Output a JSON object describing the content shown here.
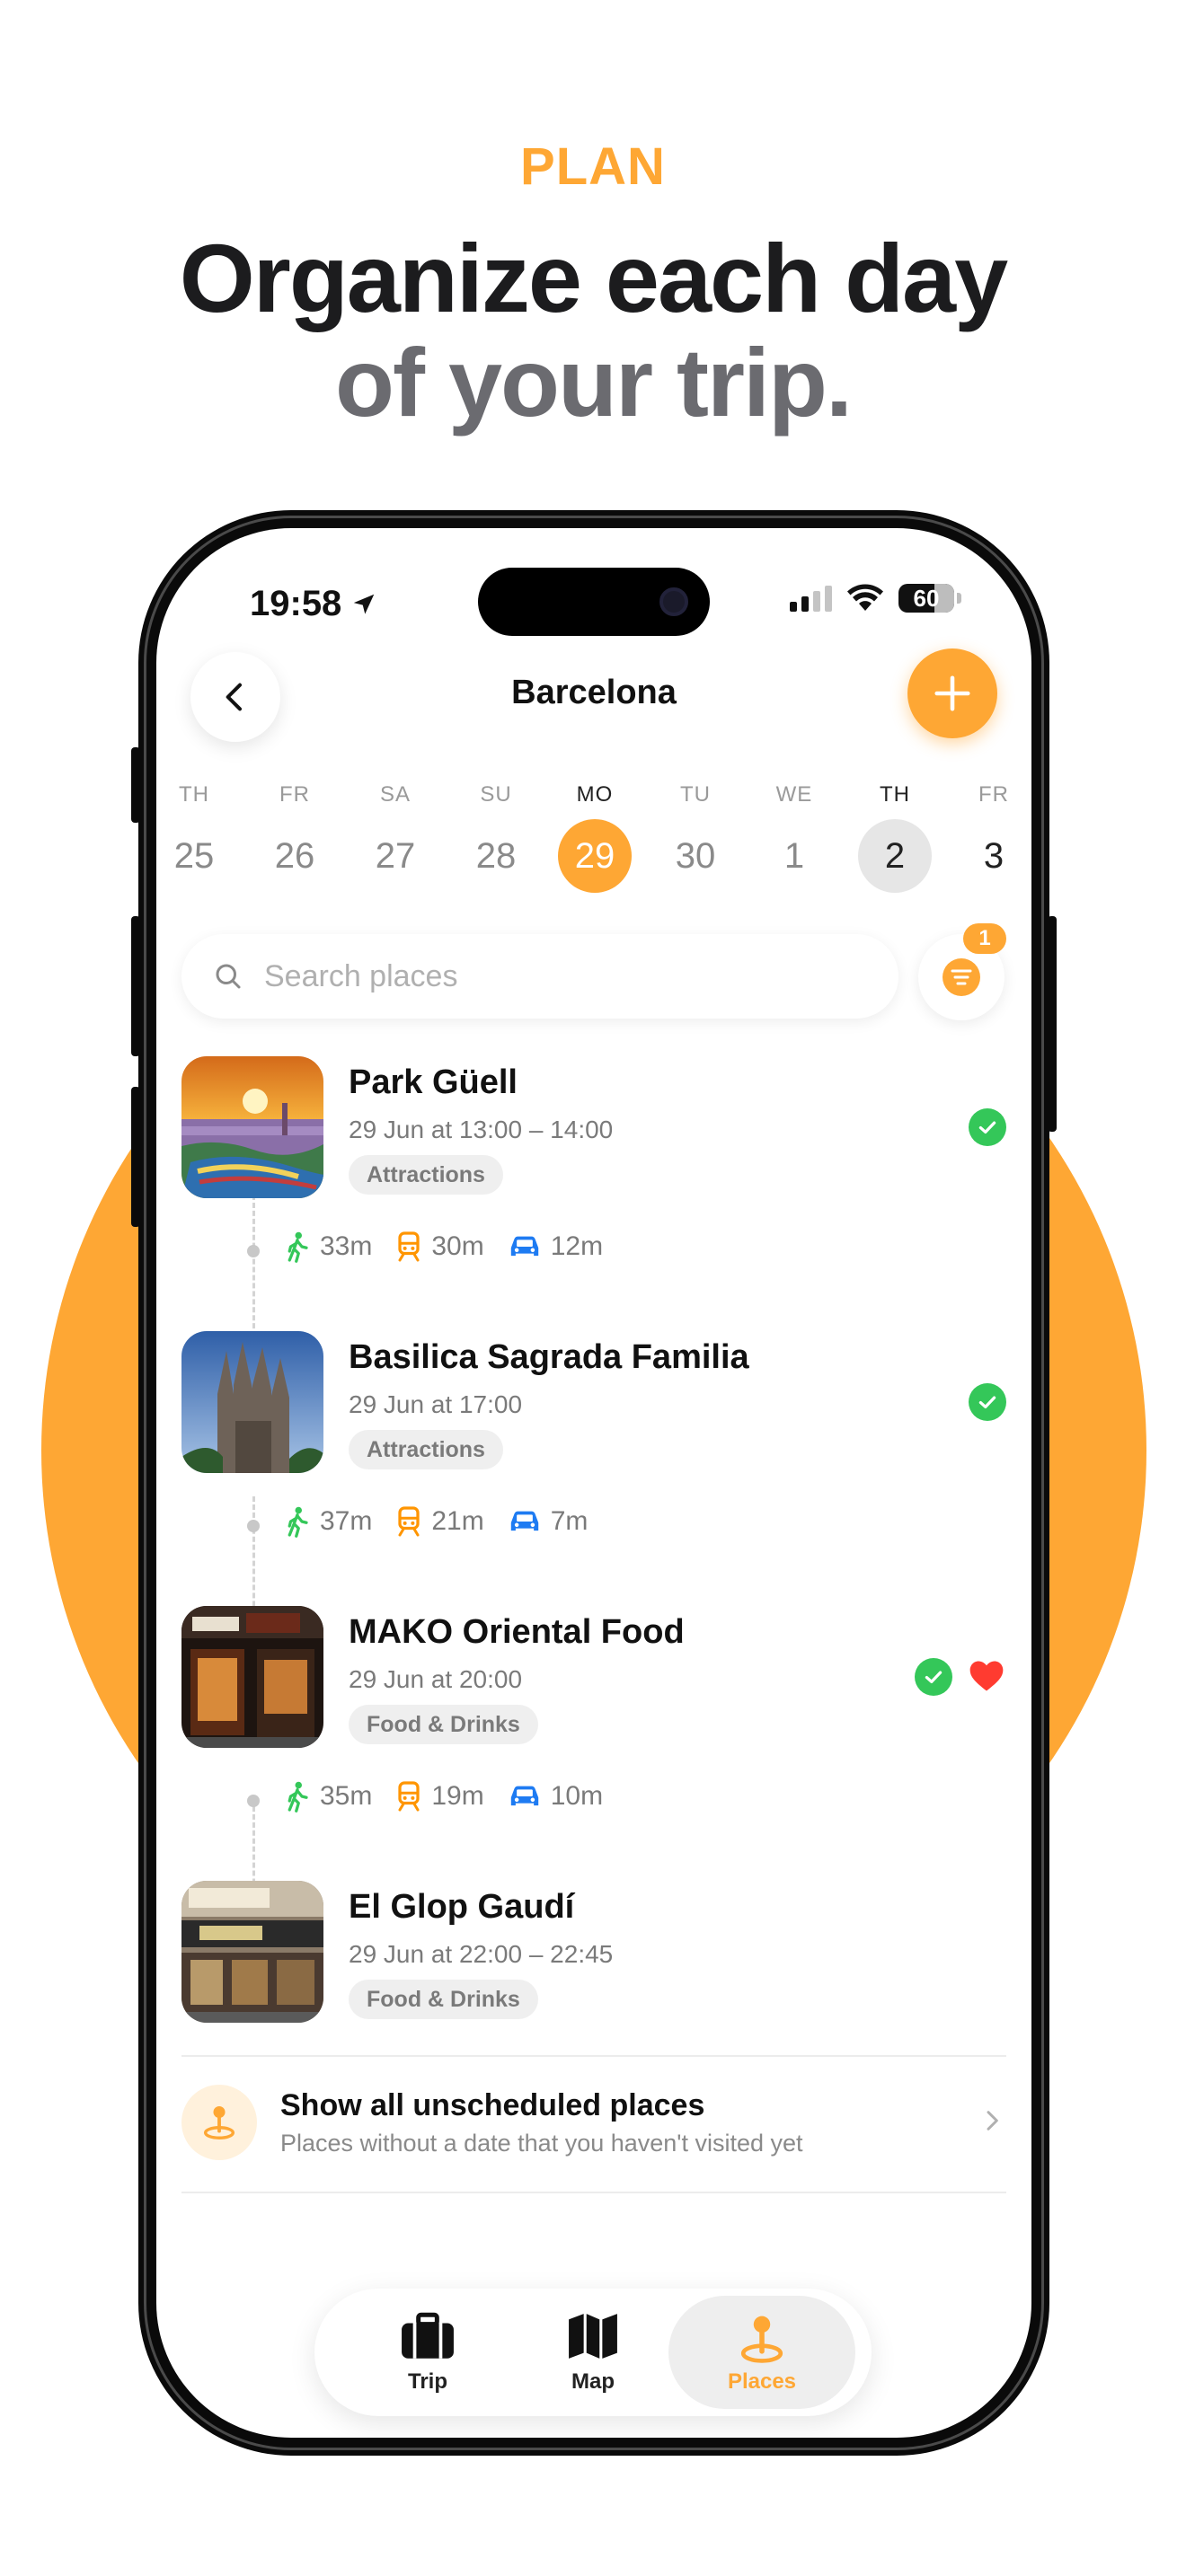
{
  "marketing": {
    "eyebrow": "PLAN",
    "headline_line1": "Organize each day",
    "headline_line2": "of your trip."
  },
  "status_bar": {
    "time": "19:58",
    "battery": "60"
  },
  "header": {
    "title": "Barcelona"
  },
  "days": [
    {
      "dow": "TH",
      "num": "25"
    },
    {
      "dow": "FR",
      "num": "26"
    },
    {
      "dow": "SA",
      "num": "27"
    },
    {
      "dow": "SU",
      "num": "28"
    },
    {
      "dow": "MO",
      "num": "29"
    },
    {
      "dow": "TU",
      "num": "30"
    },
    {
      "dow": "WE",
      "num": "1"
    },
    {
      "dow": "TH",
      "num": "2"
    },
    {
      "dow": "FR",
      "num": "3"
    }
  ],
  "search": {
    "placeholder": "Search places",
    "filter_count": "1"
  },
  "places": [
    {
      "name": "Park Güell",
      "time": "29 Jun at 13:00 – 14:00",
      "tag": "Attractions",
      "visited": true,
      "favorite": false
    },
    {
      "name": "Basilica Sagrada Familia",
      "time": "29 Jun at 17:00",
      "tag": "Attractions",
      "visited": true,
      "favorite": false
    },
    {
      "name": "MAKO Oriental Food",
      "time": "29 Jun at 20:00",
      "tag": "Food & Drinks",
      "visited": true,
      "favorite": true
    },
    {
      "name": "El Glop Gaudí",
      "time": "29 Jun at 22:00 – 22:45",
      "tag": "Food & Drinks",
      "visited": false,
      "favorite": false
    }
  ],
  "routes": [
    {
      "walk": "33m",
      "transit": "30m",
      "car": "12m"
    },
    {
      "walk": "37m",
      "transit": "21m",
      "car": "7m"
    },
    {
      "walk": "35m",
      "transit": "19m",
      "car": "10m"
    }
  ],
  "unscheduled": {
    "title": "Show all unscheduled places",
    "subtitle": "Places without a date that you haven't visited yet"
  },
  "tabs": [
    {
      "label": "Trip",
      "icon": "suitcase-icon"
    },
    {
      "label": "Map",
      "icon": "map-icon"
    },
    {
      "label": "Places",
      "icon": "pin-icon"
    }
  ],
  "colors": {
    "accent": "#FEA734",
    "visited": "#34C759",
    "favorite": "#FF3B30",
    "walk": "#34C759",
    "transit": "#FF9500",
    "car": "#1E7BF2"
  }
}
